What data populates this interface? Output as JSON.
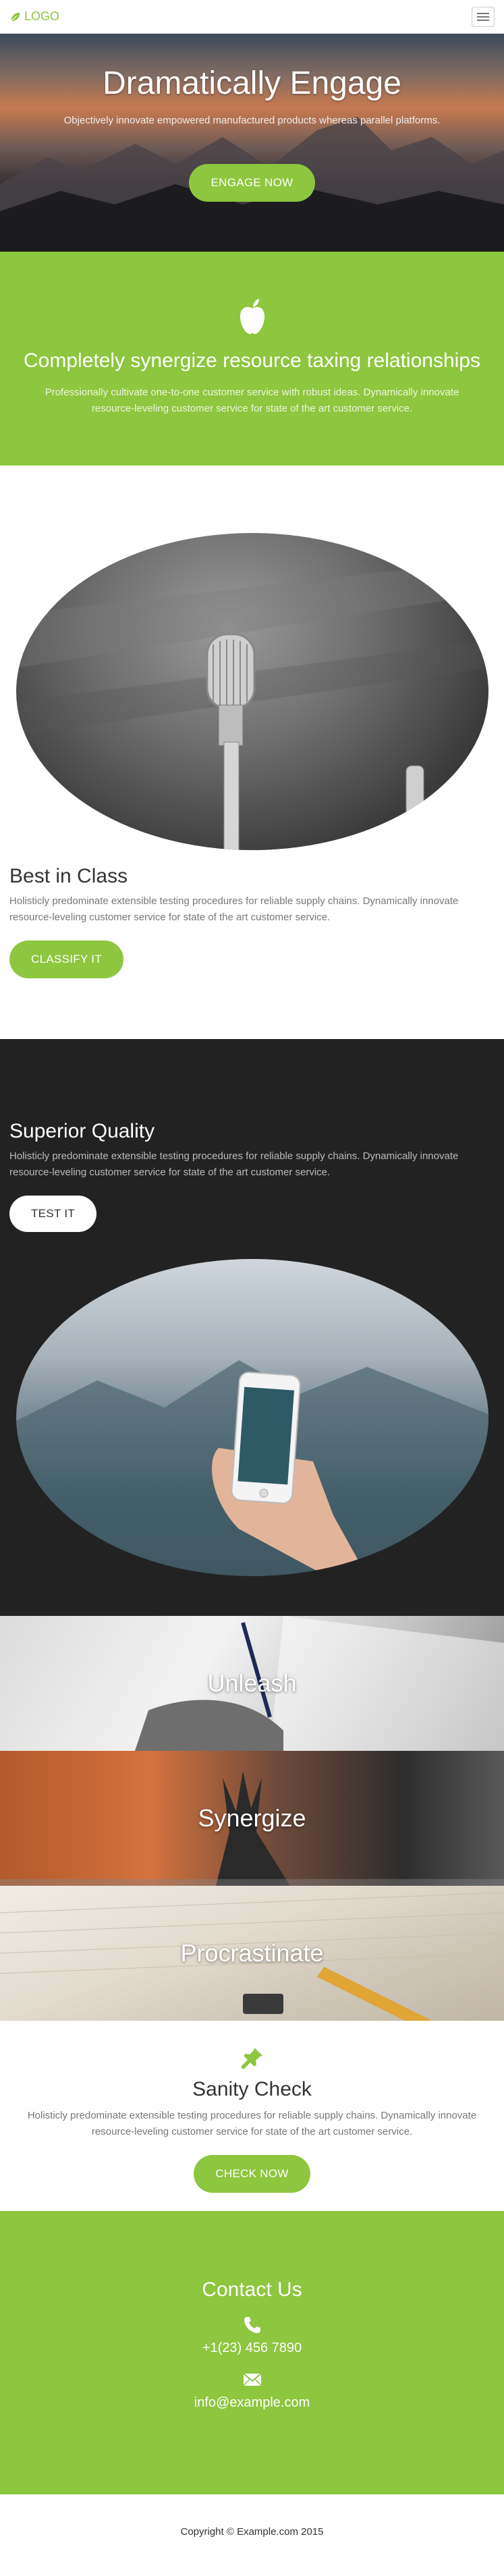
{
  "nav": {
    "logo_text": "LOGO",
    "logo_icon": "leaf-icon",
    "menu_icon": "hamburger-icon"
  },
  "hero": {
    "title": "Dramatically Engage",
    "subtitle": "Objectively innovate empowered manufactured products whereas parallel platforms.",
    "button": "ENGAGE NOW"
  },
  "feature": {
    "icon": "apple-icon",
    "title": "Completely synergize resource taxing relationships",
    "text": "Professionally cultivate one-to-one customer service with robust ideas. Dynamically innovate resource-leveling customer service for state of the art customer service."
  },
  "best": {
    "title": "Best in Class",
    "text": "Holisticly predominate extensible testing procedures for reliable supply chains. Dynamically innovate resource-leveling customer service for state of the art customer service.",
    "button": "CLASSIFY IT"
  },
  "quality": {
    "title": "Superior Quality",
    "text": "Holisticly predominate extensible testing procedures for reliable supply chains. Dynamically innovate resource-leveling customer service for state of the art customer service.",
    "button": "TEST IT"
  },
  "banners": [
    "Unleash",
    "Synergize",
    "Procrastinate"
  ],
  "sanity": {
    "icon": "pushpin-icon",
    "title": "Sanity Check",
    "text": "Holisticly predominate extensible testing procedures for reliable supply chains. Dynamically innovate resource-leveling customer service for state of the art customer service.",
    "button": "CHECK NOW"
  },
  "contact": {
    "title": "Contact Us",
    "phone": "+1(23) 456 7890",
    "email": "info@example.com"
  },
  "footer": {
    "copyright": "Copyright © Example.com 2015"
  },
  "colors": {
    "accent": "#8dc63f",
    "dark": "#222222"
  }
}
